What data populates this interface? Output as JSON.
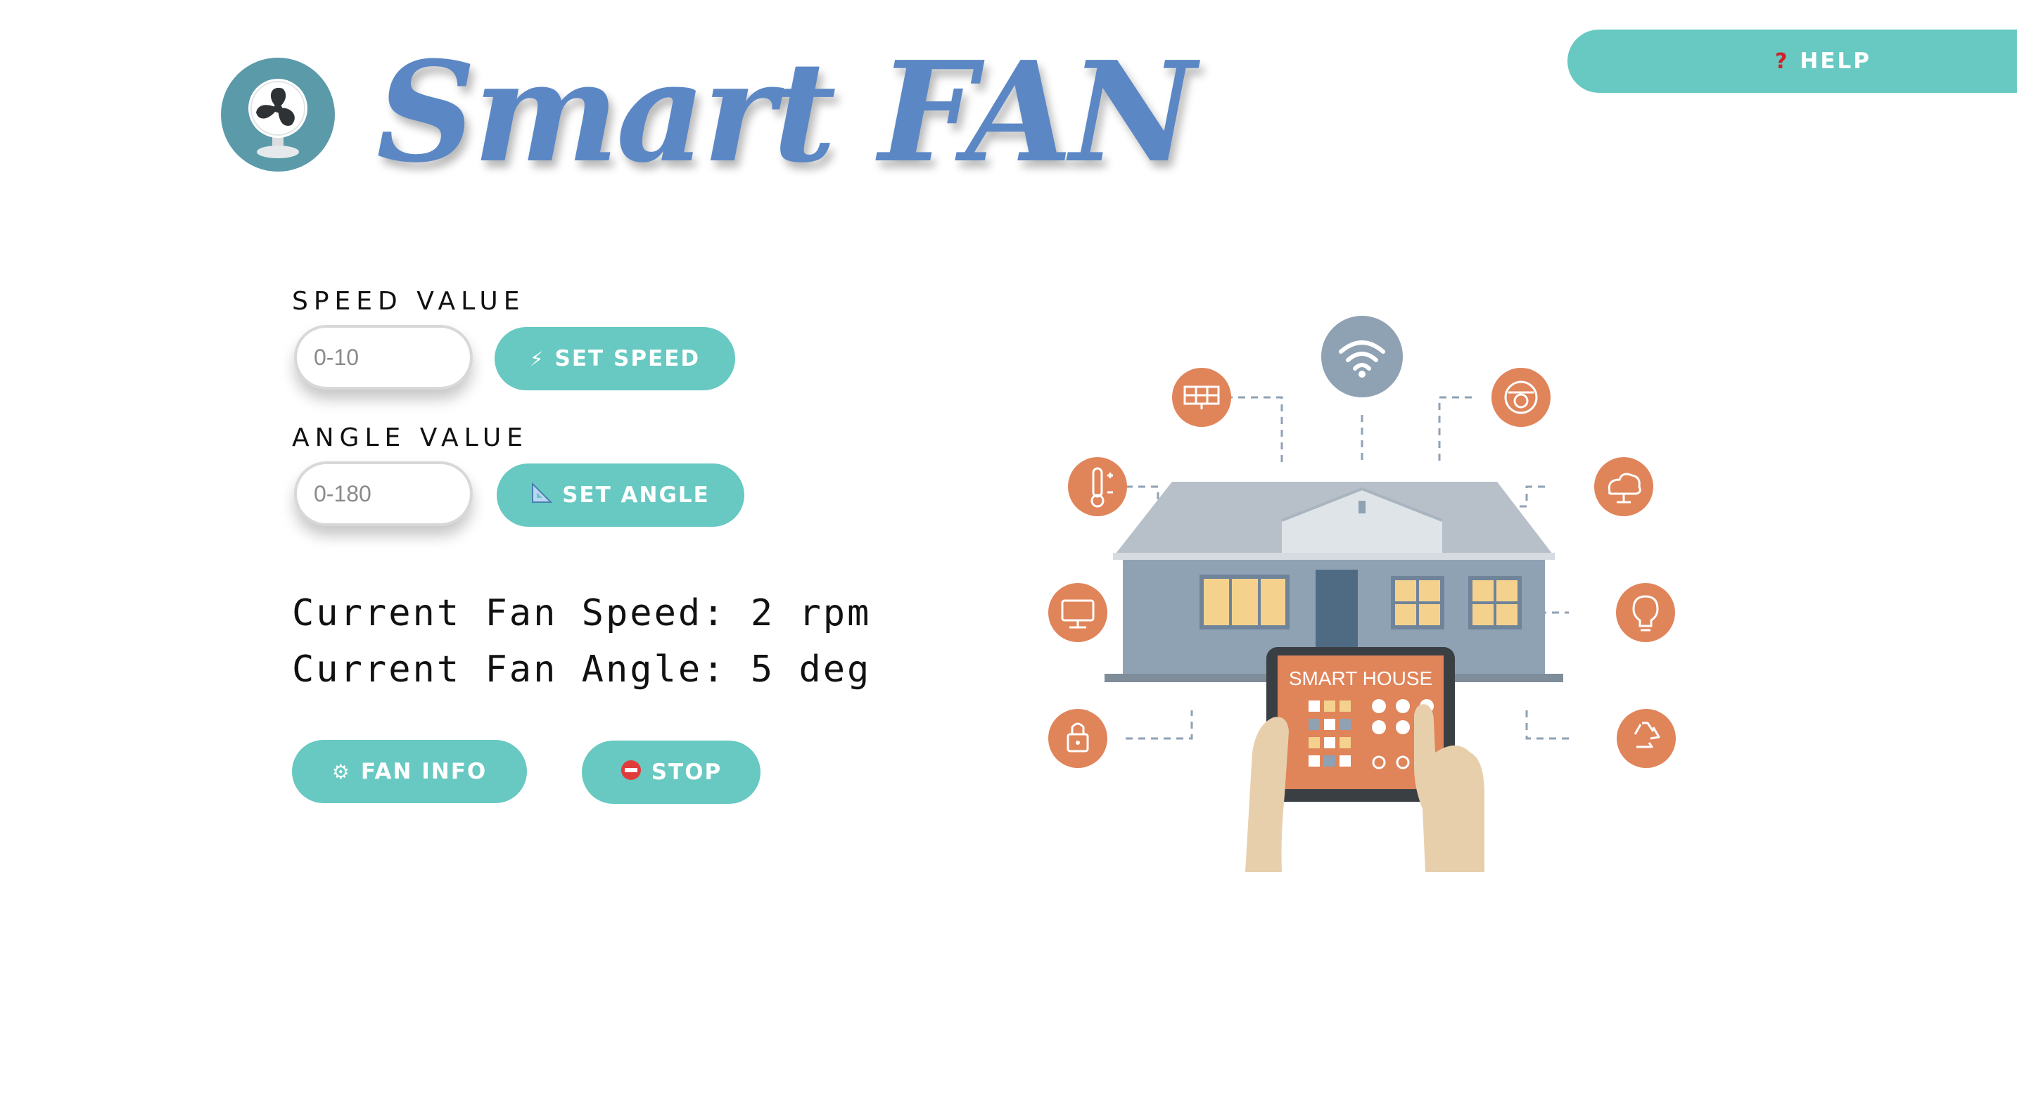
{
  "header": {
    "title": "Smart FAN",
    "logo_icon": "fan-icon",
    "help_label": "HELP",
    "help_icon": "question-mark-icon"
  },
  "controls": {
    "speed": {
      "label": "SPEED VALUE",
      "placeholder": "0-10",
      "value": "",
      "button_label": "SET SPEED",
      "button_icon": "lightning-icon"
    },
    "angle": {
      "label": "ANGLE VALUE",
      "placeholder": "0-180",
      "value": "",
      "button_label": "SET ANGLE",
      "button_icon": "triangle-ruler-icon"
    }
  },
  "status": {
    "speed_text": "Current Fan Speed: 2 rpm",
    "angle_text": "Current Fan Angle: 5 deg"
  },
  "actions": {
    "fan_info_label": "FAN INFO",
    "fan_info_icon": "gear-icon",
    "stop_label": "STOP",
    "stop_icon": "no-entry-icon"
  },
  "illustration": {
    "tablet_title": "SMART HOUSE",
    "icons": [
      "wifi-icon",
      "solar-panel-icon",
      "camera-icon",
      "thermometer-icon",
      "cloud-icon",
      "monitor-icon",
      "light-bulb-icon",
      "lock-icon",
      "recycle-icon"
    ]
  },
  "colors": {
    "accent": "#67c9c1",
    "title": "#5b87c5",
    "logo_bg": "#5b9aa9",
    "illustration_orange": "#e0845a",
    "illustration_gray": "#8fa2b4"
  }
}
